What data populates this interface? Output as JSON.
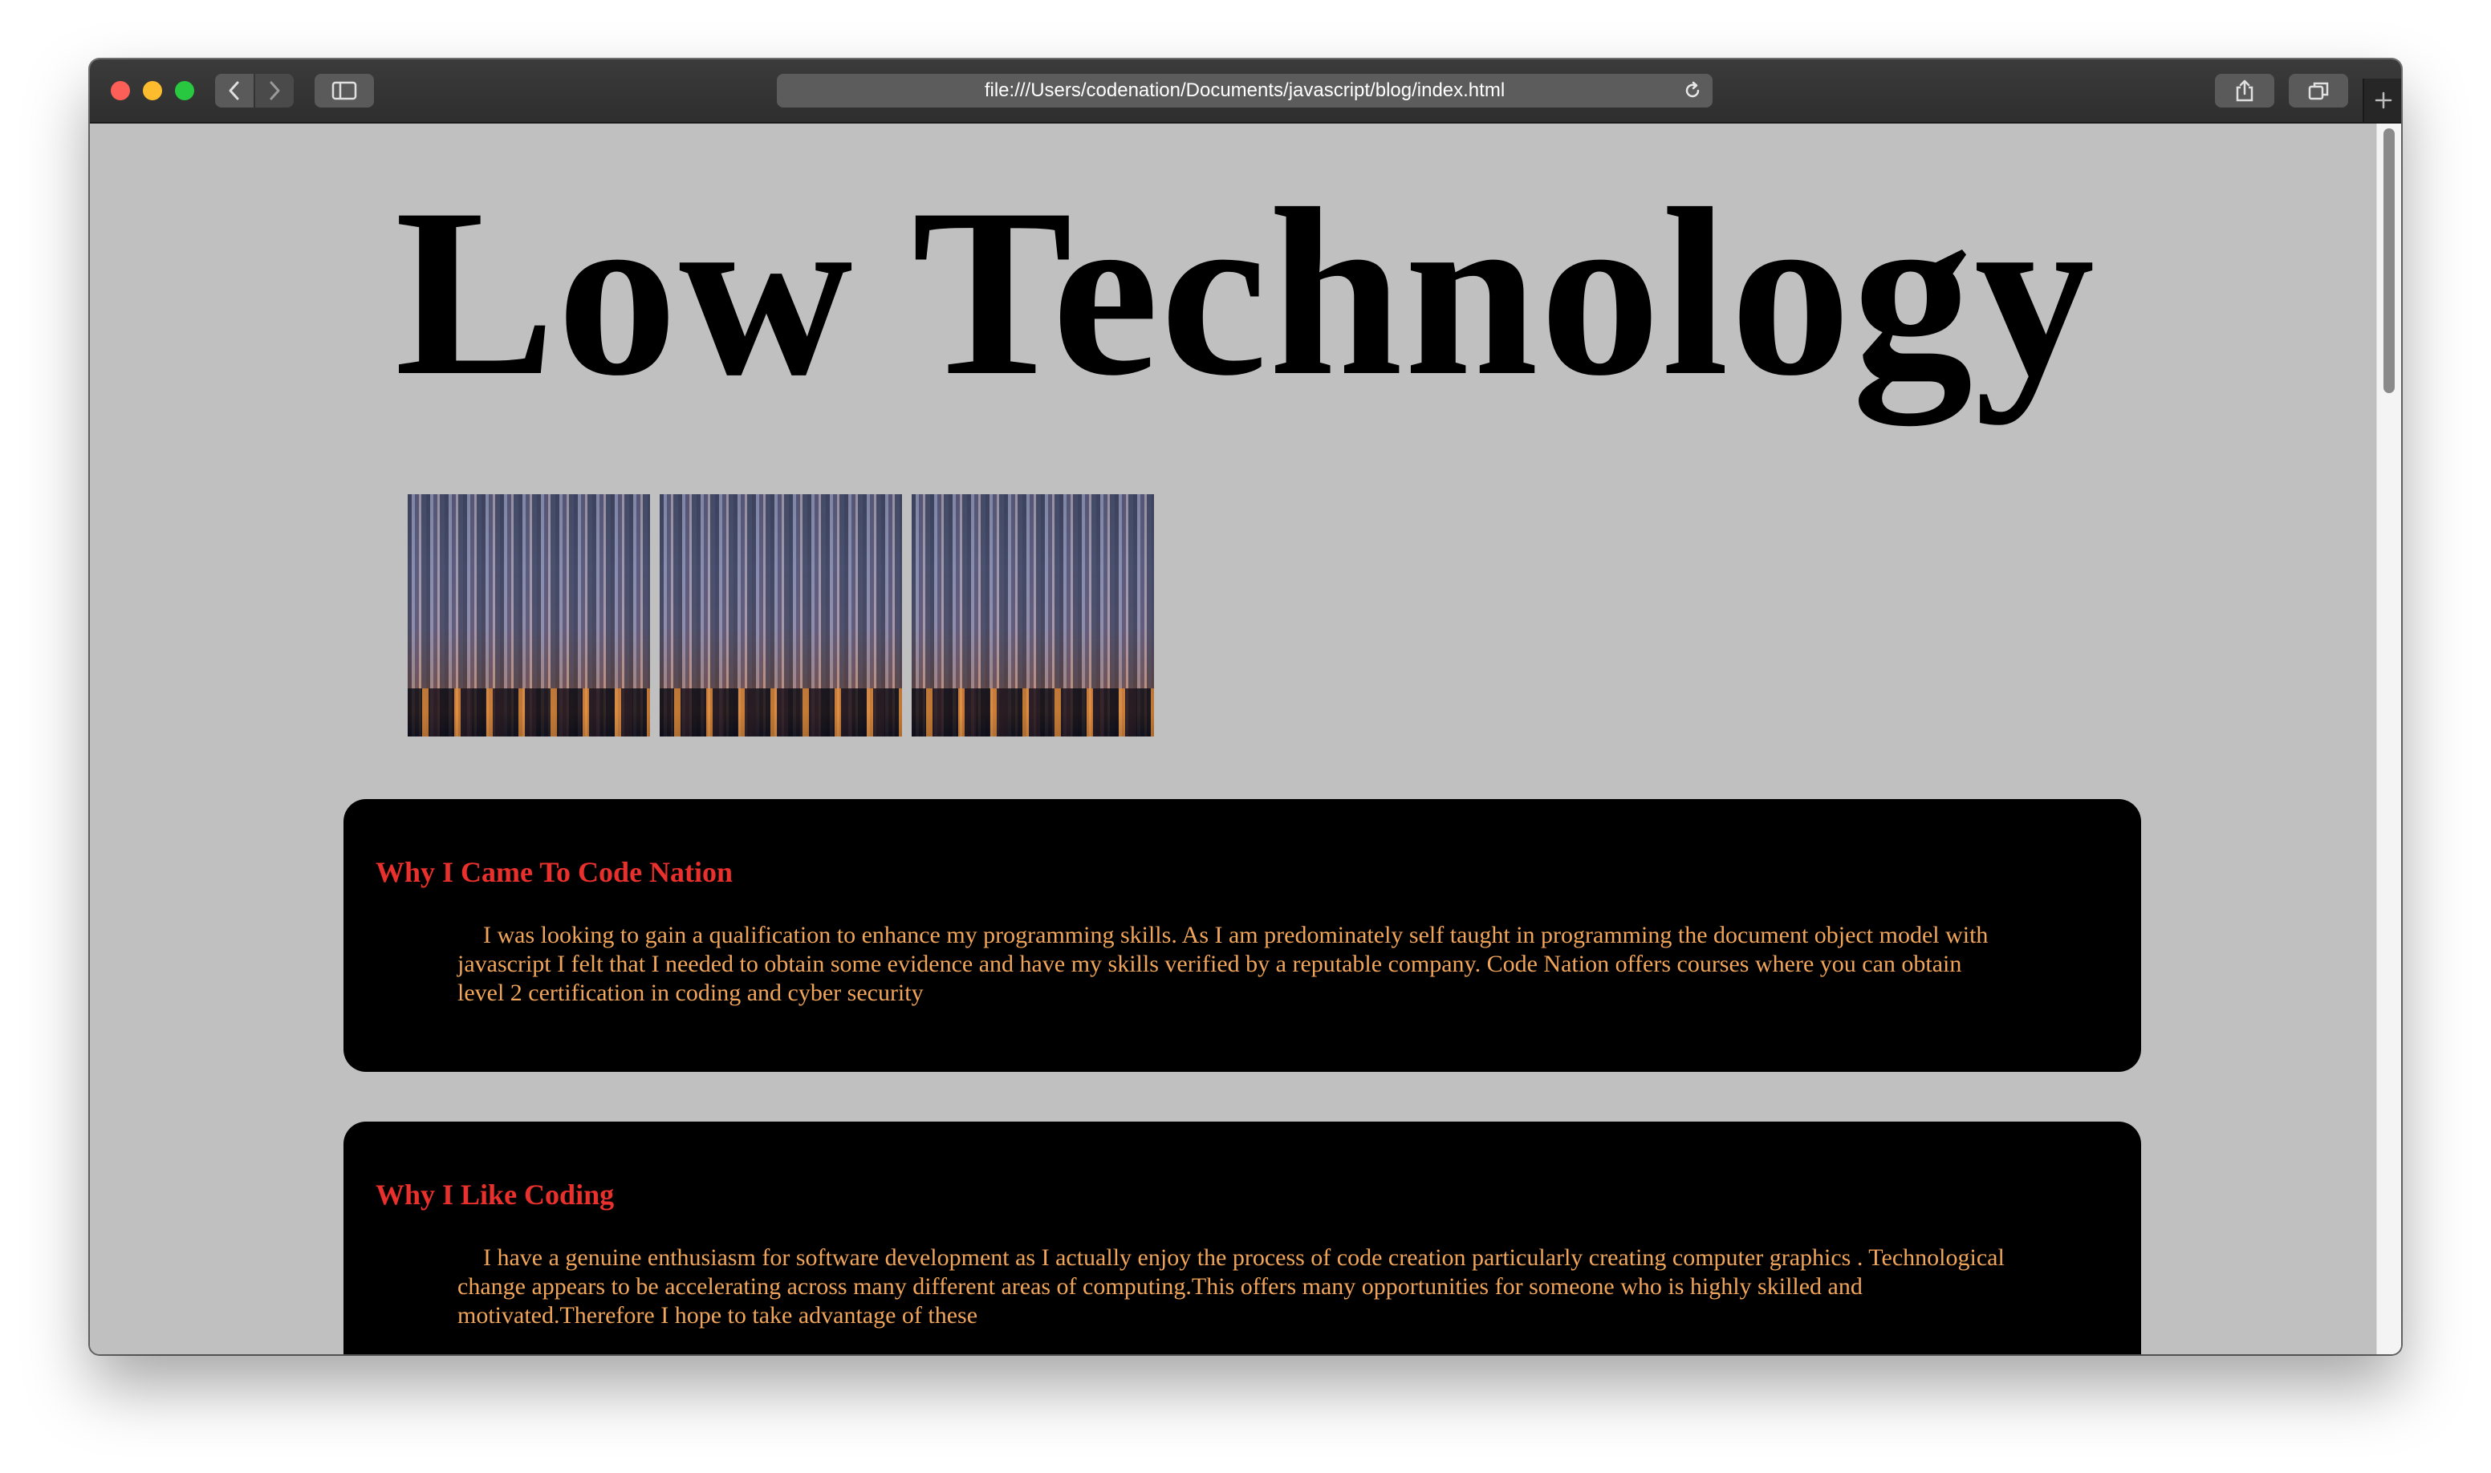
{
  "browser": {
    "url": "file:///Users/codenation/Documents/javascript/blog/index.html",
    "icons": {
      "back": "chevron-left-icon",
      "forward": "chevron-right-icon",
      "sidebar": "sidebar-icon",
      "reload": "reload-icon",
      "share": "share-icon",
      "tabs": "tabs-icon",
      "new_tab": "plus-icon"
    }
  },
  "page": {
    "title": "Low Technology",
    "background_color": "#c0c0c0",
    "gallery": [
      {
        "label": "city-image-1"
      },
      {
        "label": "city-image-2"
      },
      {
        "label": "city-image-3"
      }
    ],
    "sections": [
      {
        "heading": "Why I Came To Code Nation",
        "body": "I was looking to gain a qualification to enhance my programming skills. As I am predominately self taught in programming the document object model with javascript I felt that I needed to obtain some evidence and have my skills verified by a reputable company. Code Nation offers courses where you can obtain level 2 certification in coding and cyber security"
      },
      {
        "heading": "Why I Like Coding",
        "body": "I have a genuine enthusiasm for software development as I actually enjoy the process of code creation particularly creating computer graphics . Technological change appears to be accelerating across many different areas of computing.This offers many opportunities for someone who is highly skilled and motivated.Therefore I hope to take advantage of these"
      }
    ],
    "colors": {
      "heading": "#e9302c",
      "body_text": "#f0a55a",
      "card": "#000000"
    }
  }
}
